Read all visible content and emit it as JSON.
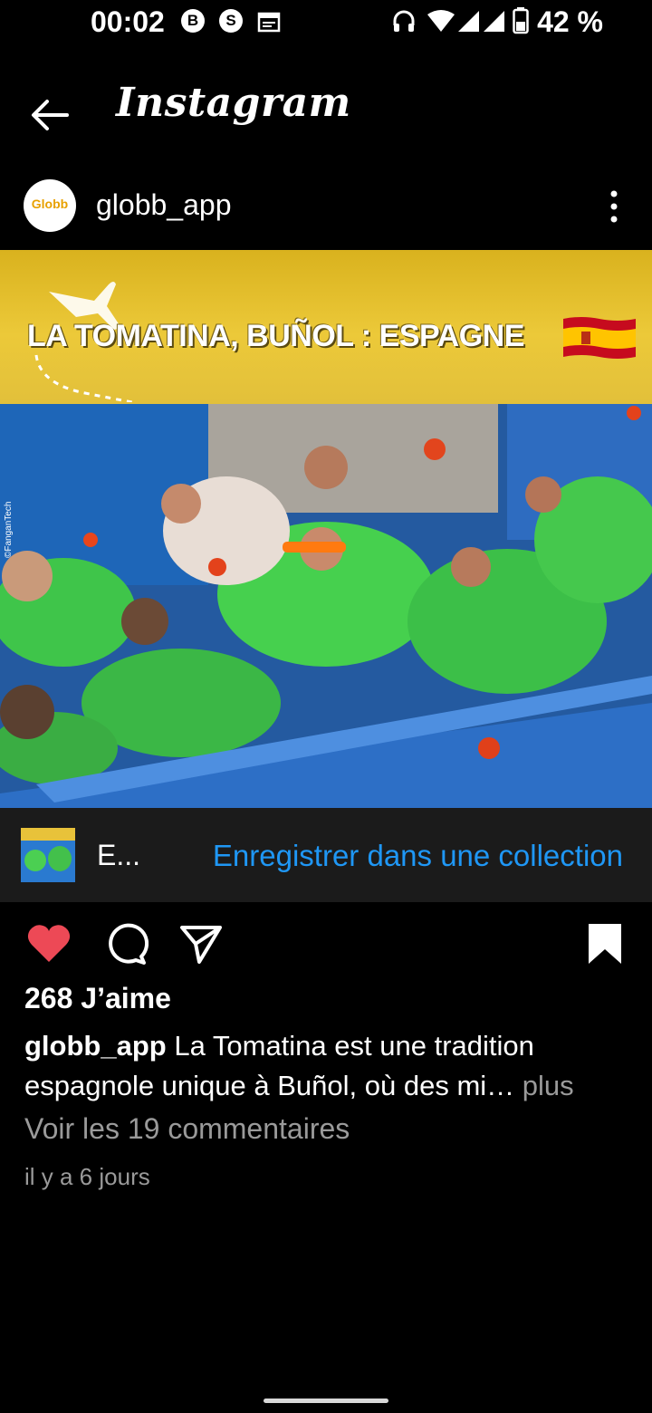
{
  "status_bar": {
    "time": "00:02",
    "icons_left": [
      "B",
      "S"
    ],
    "battery": "42 %"
  },
  "app": {
    "title": "Instagram"
  },
  "post": {
    "username": "globb_app",
    "avatar_text": "Globb",
    "banner_title": "LA TOMATINA, BUÑOL : ESPAGNE",
    "watermark": "©FanganTech"
  },
  "collection": {
    "name": "E...",
    "action": "Enregistrer dans une collection"
  },
  "stats": {
    "likes": "268 J’aime",
    "caption_user": "globb_app",
    "caption_text": "La Tomatina est une tradition espagnole unique à Buñol, où des mi…",
    "caption_more": "plus",
    "comments": "Voir les 19 commentaires",
    "time_ago": "il y a 6 jours"
  },
  "colors": {
    "accent_blue": "#1f97f5",
    "like_red": "#ed4956",
    "banner_yellow": "#e8c23a"
  },
  "icons": [
    "arrow-left-icon",
    "more-vertical-icon",
    "heart-icon",
    "comment-icon",
    "share-icon",
    "bookmark-icon"
  ]
}
